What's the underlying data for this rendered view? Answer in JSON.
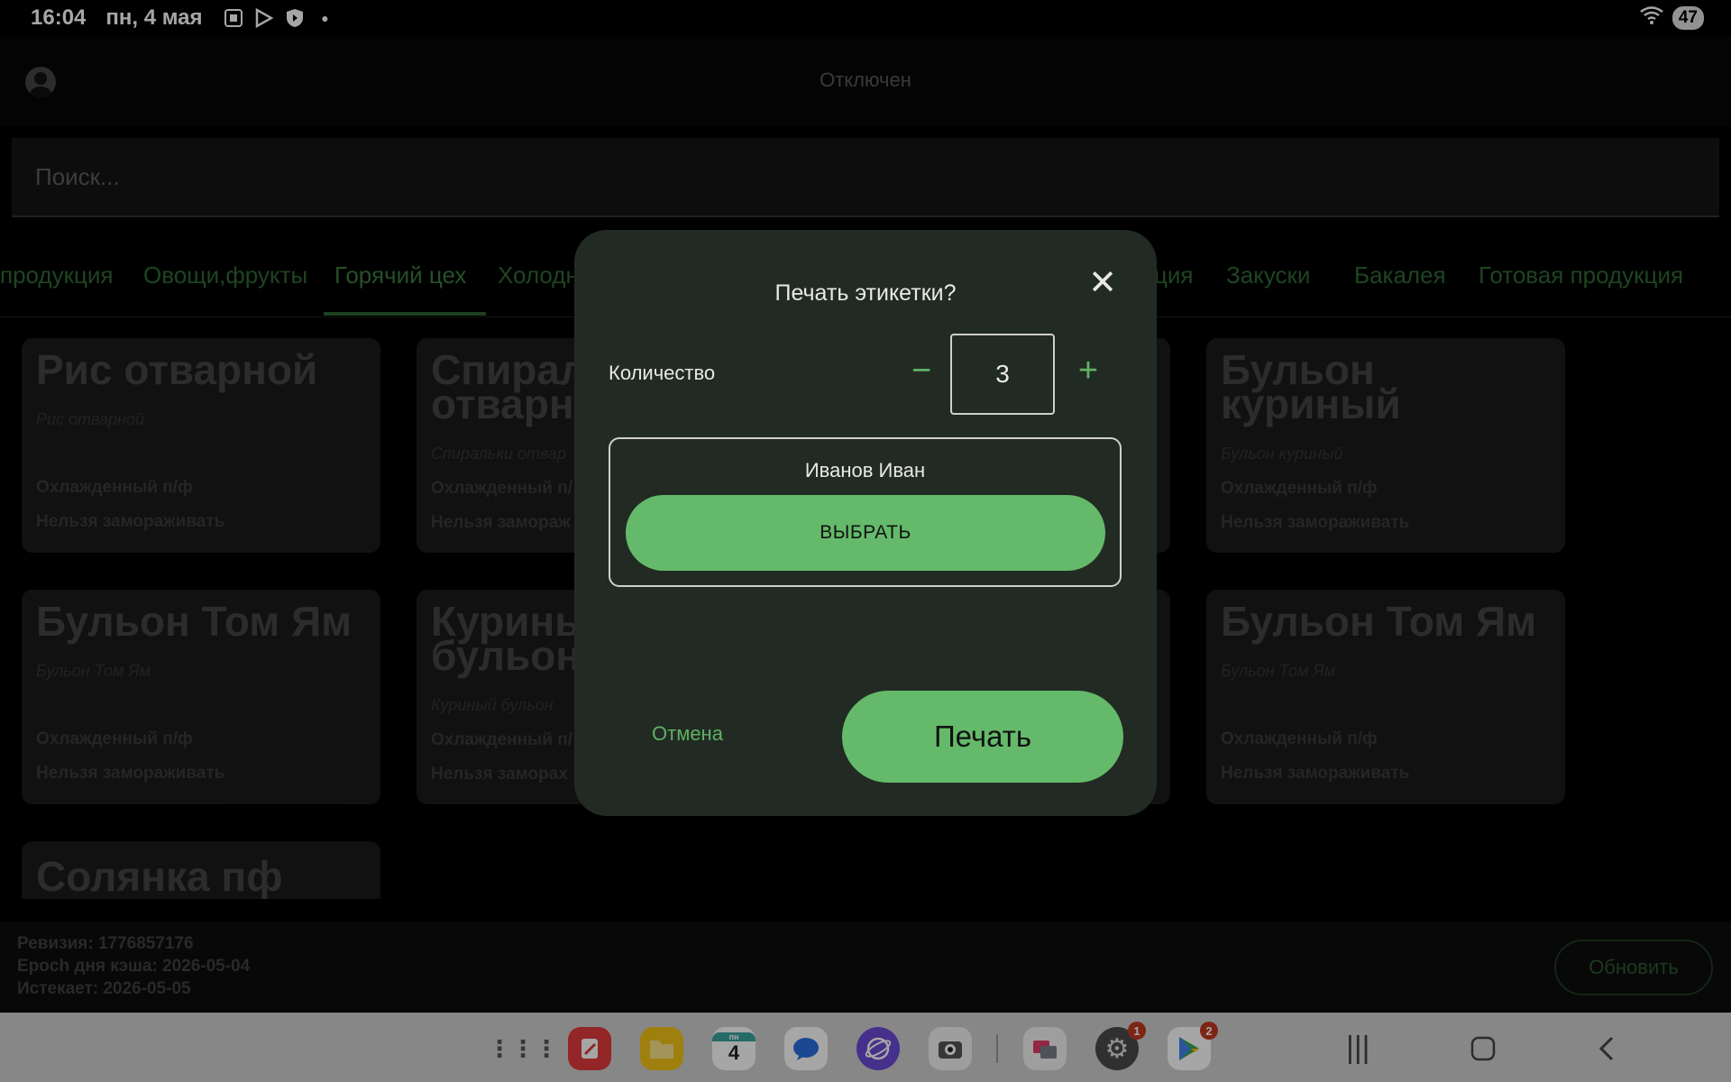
{
  "status_bar": {
    "time": "16:04",
    "date": "пн, 4 мая",
    "battery": "47"
  },
  "header": {
    "connection_status": "Отключен"
  },
  "search": {
    "placeholder": "Поиск..."
  },
  "tabs": [
    {
      "label": "продукция"
    },
    {
      "label": "Овощи,фрукты"
    },
    {
      "label": "Горячий цех"
    },
    {
      "label": "Холодн"
    },
    {
      "label": "ция"
    },
    {
      "label": "Закуски"
    },
    {
      "label": "Бакалея"
    },
    {
      "label": "Готовая продукция"
    }
  ],
  "active_tab": "Горячий цех",
  "cards": [
    {
      "title": "Рис отварной",
      "subtitle": "Рис отварной",
      "tag1": "Охлажденный п/ф",
      "tag2": "Нельзя замораживать"
    },
    {
      "title": "Спирал\nотварн",
      "subtitle": "Спиральки отвар",
      "tag1": "Охлажденный п/",
      "tag2": "Нельзя замораж"
    },
    {
      "title": "Бульон\nкуриный",
      "subtitle": "Бульон куриный",
      "tag1": "Охлажденный п/ф",
      "tag2": "Нельзя замораживать"
    },
    {
      "title": "Бульон Том Ям",
      "subtitle": "Бульон Том Ям",
      "tag1": "Охлажденный п/ф",
      "tag2": "Нельзя замораживать"
    },
    {
      "title": "Куриный\nбульон",
      "subtitle": "Куриный бульон",
      "tag1": "Охлажденный п/",
      "tag2": "Нельзя заморах"
    },
    {
      "title": "Бульон Том Ям",
      "subtitle": "Бульон Том Ям",
      "tag1": "Охлажденный п/ф",
      "tag2": "Нельзя замораживать"
    },
    {
      "title": "Солянка пф"
    }
  ],
  "info": {
    "revision": "Ревизия: 1776857176",
    "epoch": "Epoch дня кэша: 2026-05-04",
    "expires": "Истекает: 2026-05-05",
    "refresh_label": "Обновить"
  },
  "dialog": {
    "title": "Печать этикетки?",
    "quantity_label": "Количество",
    "quantity_value": "3",
    "minus": "−",
    "plus": "+",
    "user_name": "Иванов Иван",
    "select_label": "ВЫБРАТЬ",
    "cancel_label": "Отмена",
    "print_label": "Печать"
  },
  "dock": {
    "calendar_day": "4",
    "calendar_weekday": "пн",
    "settings_badge": "1",
    "play_badge": "2"
  },
  "colors": {
    "accent": "#64ba6a",
    "dialog_bg": "#222b23",
    "tab_text": "#2f6a34"
  }
}
